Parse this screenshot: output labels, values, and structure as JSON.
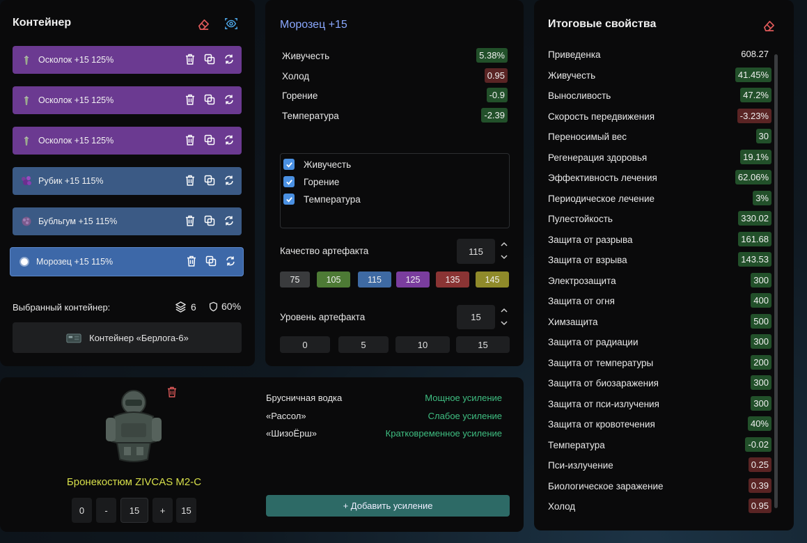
{
  "colors": {
    "purple": "#6b3a91",
    "blue": "#3b5a85",
    "green_badge": "#22502a",
    "red_badge": "#5a2424",
    "accent_blue": "#8aa8ff",
    "effect_green": "#3fbf82"
  },
  "container": {
    "title": "Контейнер",
    "artifacts": [
      {
        "label": "Осколок +15 125%",
        "icon": "shard-icon",
        "color": "purple"
      },
      {
        "label": "Осколок +15 125%",
        "icon": "shard-icon",
        "color": "purple"
      },
      {
        "label": "Осколок +15 125%",
        "icon": "shard-icon",
        "color": "purple"
      },
      {
        "label": "Рубик +15 115%",
        "icon": "cube-icon",
        "color": "blue"
      },
      {
        "label": "Бубльгум +15 115%",
        "icon": "bubble-icon",
        "color": "blue"
      },
      {
        "label": "Морозец +15 115%",
        "icon": "frost-icon",
        "color": "blue",
        "selected": true
      }
    ],
    "selected_label": "Выбранный контейнер:",
    "slots": "6",
    "protection": "60%",
    "container_name": "Контейнер «Берлога-6»"
  },
  "artifact": {
    "title": "Морозец +15",
    "props": [
      {
        "name": "Живучесть",
        "value": "5.38%",
        "tone": "green"
      },
      {
        "name": "Холод",
        "value": "0.95",
        "tone": "red"
      },
      {
        "name": "Горение",
        "value": "-0.9",
        "tone": "green"
      },
      {
        "name": "Температура",
        "value": "-2.39",
        "tone": "green"
      }
    ],
    "checks": [
      "Живучесть",
      "Горение",
      "Температура"
    ],
    "quality_label": "Качество артефакта",
    "quality_value": "115",
    "quality_options": [
      "75",
      "105",
      "115",
      "125",
      "135",
      "145"
    ],
    "level_label": "Уровень артефакта",
    "level_value": "15",
    "level_options": [
      "0",
      "5",
      "10",
      "15"
    ]
  },
  "armor": {
    "name": "Бронекостюм ZIVCAS M2-C",
    "controls": [
      "0",
      "-",
      "15",
      "+",
      "15"
    ],
    "boosts": [
      {
        "name": "Брусничная водка",
        "effect": "Мощное усиление"
      },
      {
        "name": "«Рассол»",
        "effect": "Слабое усиление"
      },
      {
        "name": "«ШизоЁрш»",
        "effect": "Кратковременное усиление"
      }
    ],
    "add_button": "+ Добавить усиление"
  },
  "totals": {
    "title": "Итоговые свойства",
    "rows": [
      {
        "name": "Приведенка",
        "value": "608.27",
        "tone": "plain"
      },
      {
        "name": "Живучесть",
        "value": "41.45%",
        "tone": "green"
      },
      {
        "name": "Выносливость",
        "value": "47.2%",
        "tone": "green"
      },
      {
        "name": "Скорость передвижения",
        "value": "-3.23%",
        "tone": "red"
      },
      {
        "name": "Переносимый вес",
        "value": "30",
        "tone": "green"
      },
      {
        "name": "Регенерация здоровья",
        "value": "19.1%",
        "tone": "green"
      },
      {
        "name": "Эффективность лечения",
        "value": "62.06%",
        "tone": "green"
      },
      {
        "name": "Периодическое лечение",
        "value": "3%",
        "tone": "green"
      },
      {
        "name": "Пулестойкость",
        "value": "330.02",
        "tone": "green"
      },
      {
        "name": "Защита от разрыва",
        "value": "161.68",
        "tone": "green"
      },
      {
        "name": "Защита от взрыва",
        "value": "143.53",
        "tone": "green"
      },
      {
        "name": "Электрозащита",
        "value": "300",
        "tone": "green"
      },
      {
        "name": "Защита от огня",
        "value": "400",
        "tone": "green"
      },
      {
        "name": "Химзащита",
        "value": "500",
        "tone": "green"
      },
      {
        "name": "Защита от радиации",
        "value": "300",
        "tone": "green"
      },
      {
        "name": "Защита от температуры",
        "value": "200",
        "tone": "green"
      },
      {
        "name": "Защита от биозаражения",
        "value": "300",
        "tone": "green"
      },
      {
        "name": "Защита от пси-излучения",
        "value": "300",
        "tone": "green"
      },
      {
        "name": "Защита от кровотечения",
        "value": "40%",
        "tone": "green"
      },
      {
        "name": "Температура",
        "value": "-0.02",
        "tone": "green"
      },
      {
        "name": "Пси-излучение",
        "value": "0.25",
        "tone": "red"
      },
      {
        "name": "Биологическое заражение",
        "value": "0.39",
        "tone": "red"
      },
      {
        "name": "Холод",
        "value": "0.95",
        "tone": "red"
      }
    ]
  }
}
